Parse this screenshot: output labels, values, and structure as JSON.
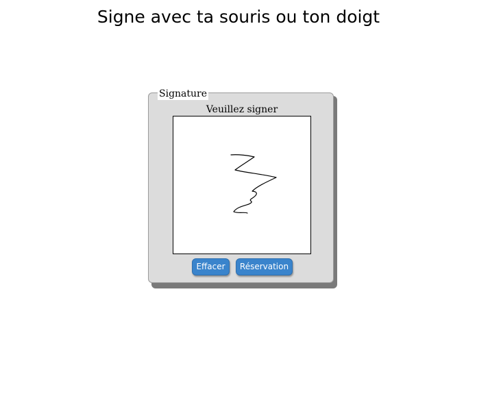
{
  "page": {
    "title": "Signe avec ta souris ou ton doigt"
  },
  "signature_panel": {
    "legend": "Signature",
    "prompt": "Veuillez signer",
    "clear_label": "Effacer",
    "reserve_label": "Réservation"
  },
  "colors": {
    "panel_background": "#dcdcdc",
    "button_background": "#3a84cc",
    "button_text": "#ffffff",
    "stroke": "#000000"
  }
}
